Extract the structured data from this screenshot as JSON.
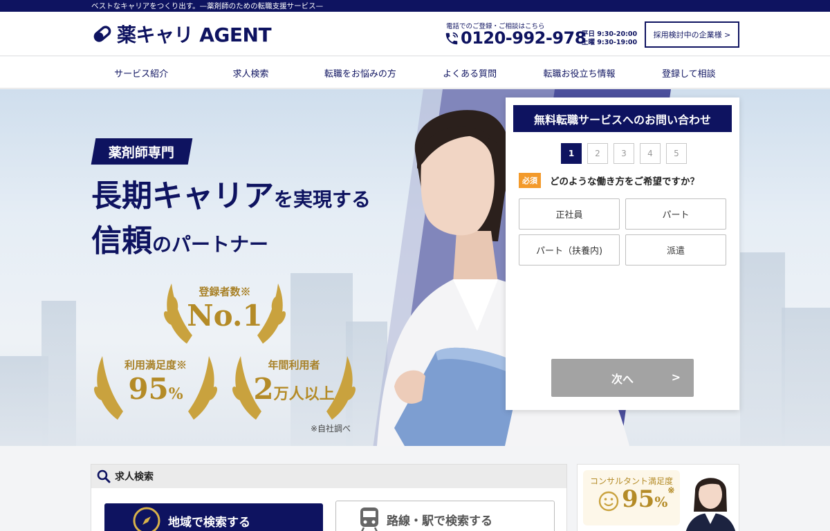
{
  "topbar": {
    "tagline": "ベストなキャリアをつくり出す。—薬剤師のための転職支援サービス—"
  },
  "header": {
    "logo_text": "薬キャリ AGENT",
    "phone_note": "電話でのご登録・ご相談はこちら",
    "phone_number": "0120-992-978",
    "hours_weekday": "平日 9:30-20:00",
    "hours_saturday": "土曜 9:30-19:00",
    "corporate_button": "採用検討中の企業様 >"
  },
  "nav": {
    "items": [
      "サービス紹介",
      "求人検索",
      "転職をお悩みの方",
      "よくある質問",
      "転職お役立ち情報",
      "登録して相談"
    ]
  },
  "hero": {
    "badge": "薬剤師専門",
    "headline_1_big": "長期キャリア",
    "headline_1_small": "を実現する",
    "headline_2_big": "信頼",
    "headline_2_small": "のパートナー",
    "award_1_caption": "登録者数※",
    "award_1_value": "No.1",
    "award_2_caption": "利用満足度※",
    "award_2_value": "95",
    "award_2_unit": "%",
    "award_3_caption": "年間利用者",
    "award_3_value": "2",
    "award_3_unit": "万人以上",
    "note": "※自社調べ"
  },
  "form": {
    "title": "無料転職サービスへのお問い合わせ",
    "steps": [
      "1",
      "2",
      "3",
      "4",
      "5"
    ],
    "active_step": 1,
    "required_label": "必須",
    "question": "どのような働き方をご希望ですか？",
    "options": [
      "正社員",
      "パート",
      "パート（扶養内)",
      "派遣"
    ],
    "next_button": "次へ",
    "next_chevron": ">"
  },
  "search": {
    "title": "求人検索",
    "region_button": "地域で検索する",
    "station_button": "路線・駅で検索する"
  },
  "side": {
    "caption": "コンサルタント満足度",
    "value": "95",
    "unit": "%",
    "note_mark": "※"
  },
  "colors": {
    "navy": "#0e1360",
    "gold": "#b48b27",
    "orange": "#f39a2b",
    "gray_button": "#a3a3a3"
  }
}
